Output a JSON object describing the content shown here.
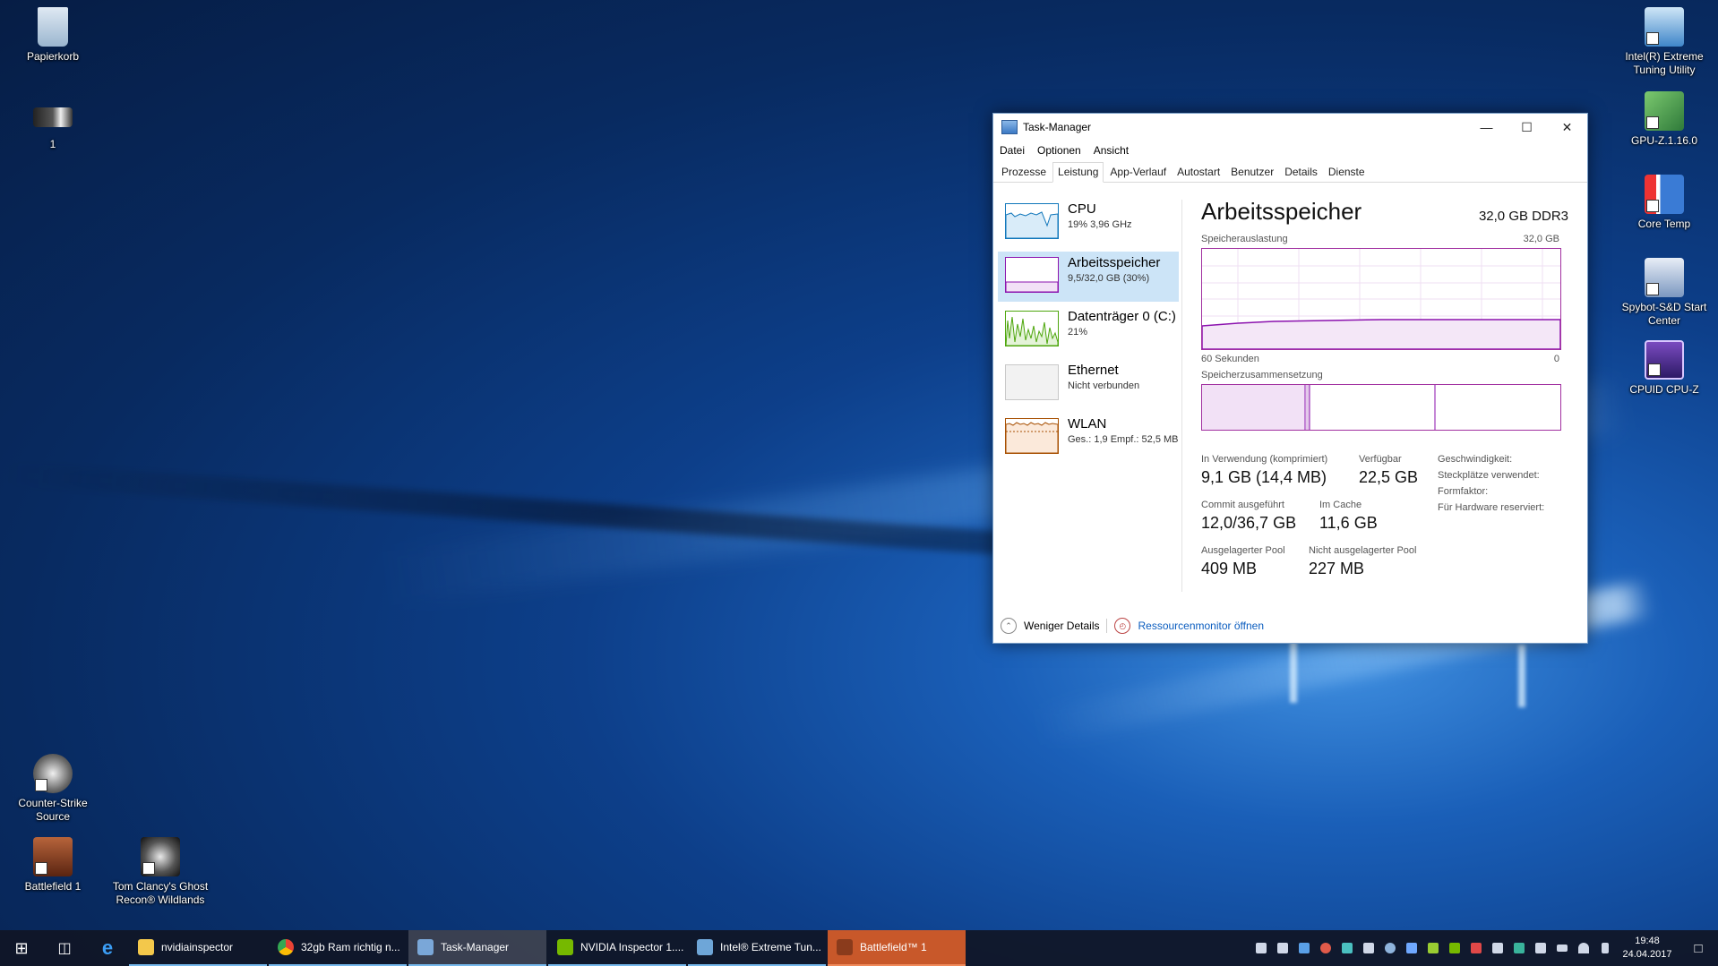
{
  "desktop": {
    "icons_left": [
      {
        "label": "Papierkorb",
        "icon": "recycle-bin-icon"
      },
      {
        "label": "1",
        "icon": "image-file-icon"
      },
      {
        "label": "Counter-Strike Source",
        "icon": "cs-source-icon"
      },
      {
        "label": "Battlefield 1",
        "icon": "battlefield-icon"
      },
      {
        "label": "Tom Clancy's Ghost Recon® Wildlands",
        "icon": "ghost-recon-icon"
      }
    ],
    "icons_right": [
      {
        "label": "Intel(R) Extreme Tuning Utility",
        "icon": "intel-xtu-icon"
      },
      {
        "label": "GPU-Z.1.16.0",
        "icon": "gpu-z-icon"
      },
      {
        "label": "Core Temp",
        "icon": "core-temp-icon"
      },
      {
        "label": "Spybot-S&D Start Center",
        "icon": "spybot-icon"
      },
      {
        "label": "CPUID CPU-Z",
        "icon": "cpu-z-icon"
      }
    ]
  },
  "window": {
    "title": "Task-Manager",
    "menu": [
      "Datei",
      "Optionen",
      "Ansicht"
    ],
    "tabs": [
      "Prozesse",
      "Leistung",
      "App-Verlauf",
      "Autostart",
      "Benutzer",
      "Details",
      "Dienste"
    ],
    "active_tab": "Leistung",
    "sidebar": [
      {
        "name": "CPU",
        "sub": "19% 3,96 GHz",
        "color": "#1177bb"
      },
      {
        "name": "Arbeitsspeicher",
        "sub": "9,5/32,0 GB (30%)",
        "color": "#8b12ae"
      },
      {
        "name": "Datenträger 0 (C:)",
        "sub": "21%",
        "color": "#4da60c"
      },
      {
        "name": "Ethernet",
        "sub": "Nicht verbunden",
        "color": "#a0a0a0"
      },
      {
        "name": "WLAN",
        "sub": "Ges.: 1,9 Empf.: 52,5 MB",
        "color": "#a74f01"
      }
    ],
    "main": {
      "title": "Arbeitsspeicher",
      "spec": "32,0 GB DDR3",
      "usage_label": "Speicherauslastung",
      "usage_max": "32,0 GB",
      "time_label": "60 Sekunden",
      "time_zero": "0",
      "composition_label": "Speicherzusammensetzung",
      "stats": {
        "in_use_label": "In Verwendung (komprimiert)",
        "in_use_value": "9,1 GB (14,4 MB)",
        "available_label": "Verfügbar",
        "available_value": "22,5 GB",
        "commit_label": "Commit ausgeführt",
        "commit_value": "12,0/36,7 GB",
        "cache_label": "Im Cache",
        "cache_value": "11,6 GB",
        "paged_label": "Ausgelagerter Pool",
        "paged_value": "409 MB",
        "nonpaged_label": "Nicht ausgelagerter Pool",
        "nonpaged_value": "227 MB"
      },
      "right_labels": [
        "Geschwindigkeit:",
        "Steckplätze verwendet:",
        "Formfaktor:",
        "Für Hardware reserviert:"
      ]
    },
    "footer": {
      "less_details": "Weniger Details",
      "resource_monitor": "Ressourcenmonitor öffnen"
    }
  },
  "taskbar": {
    "buttons": [
      {
        "label": "nvidiainspector",
        "icon": "folder-icon",
        "color": "#f3c84b"
      },
      {
        "label": "32gb Ram richtig n...",
        "icon": "chrome-icon",
        "color": "#4285f4"
      },
      {
        "label": "Task-Manager",
        "icon": "task-manager-icon",
        "color": "#7aa7d8"
      },
      {
        "label": "NVIDIA Inspector 1....",
        "icon": "nvidia-icon",
        "color": "#76b900"
      },
      {
        "label": "Intel® Extreme Tun...",
        "icon": "intel-xtu-icon",
        "color": "#6ea6d8"
      },
      {
        "label": "Battlefield™ 1",
        "icon": "battlefield-icon",
        "color": "#8a3b1c"
      }
    ],
    "clock_time": "19:48",
    "clock_date": "24.04.2017"
  }
}
